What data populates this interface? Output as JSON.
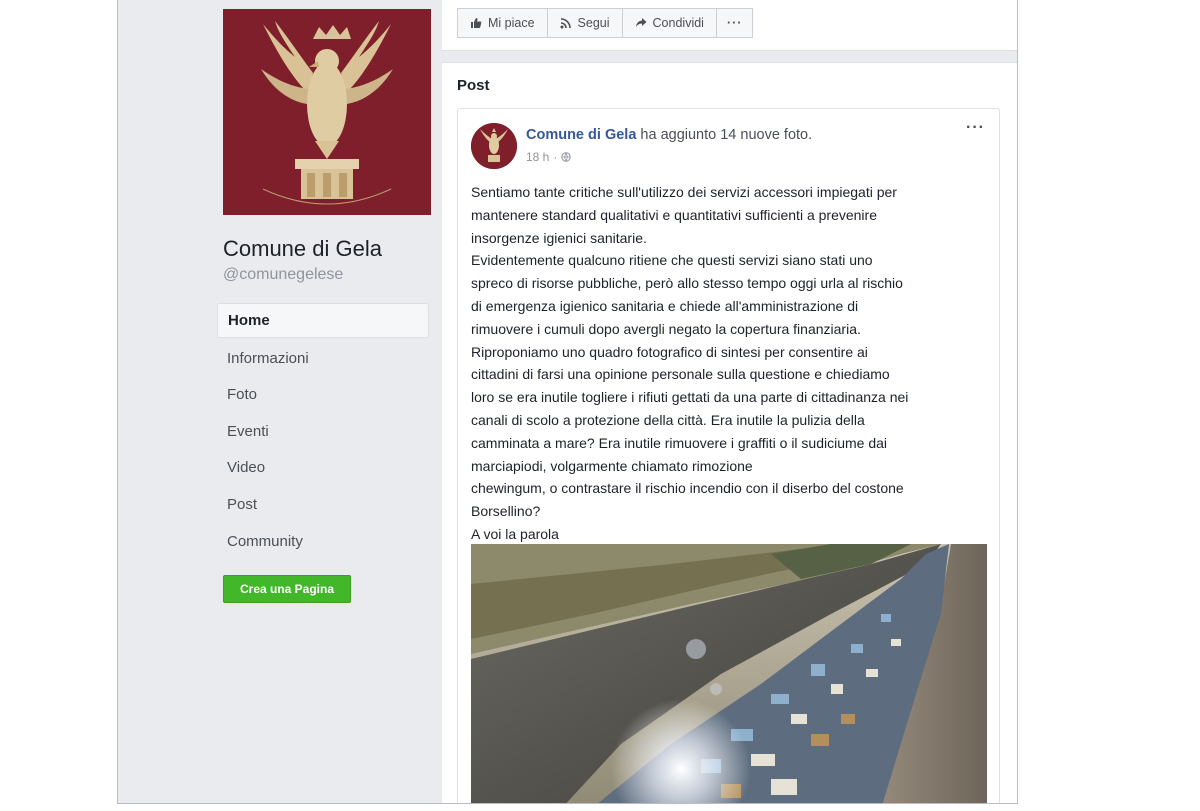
{
  "page": {
    "name": "Comune di Gela",
    "handle": "@comunegelese",
    "nav": [
      "Home",
      "Informazioni",
      "Foto",
      "Eventi",
      "Video",
      "Post",
      "Community"
    ],
    "active_nav": "Home",
    "create_page_label": "Crea una Pagina",
    "logo_inscription": "MVNICIPIO GELENSE"
  },
  "actions": {
    "like_label": "Mi piace",
    "follow_label": "Segui",
    "share_label": "Condividi",
    "more_label": "···"
  },
  "posts_section": {
    "title": "Post"
  },
  "post": {
    "author": "Comune di Gela",
    "action_text": "ha aggiunto 14 nuove foto.",
    "time": "18 h",
    "menu_label": "···",
    "lines": [
      "Sentiamo tante critiche sull'utilizzo dei servizi accessori impiegati per",
      "mantenere standard qualitativi e quantitativi sufficienti a prevenire",
      "insorgenze igienici sanitarie.",
      "Evidentemente qualcuno ritiene che questi servizi siano stati uno",
      "spreco di risorse pubbliche, però allo stesso tempo oggi urla al rischio",
      "di emergenza igienico sanitaria e chiede all'amministrazione di",
      "rimuovere i cumuli dopo avergli negato la copertura finanziaria.",
      "Riproponiamo uno quadro fotografico di sintesi per consentire ai",
      "cittadini di farsi una opinione personale sulla questione e chiediamo",
      "loro se era inutile togliere i rifiuti gettati da una parte di cittadinanza nei",
      "canali di scolo a protezione della città. Era inutile la pulizia della",
      "camminata a mare? Era inutile rimuovere i graffiti o il sudiciume dai",
      "marciapiodi, volgarmente chiamato rimozione",
      "chewingum, o contrastare il rischio incendio con il diserbo del costone",
      "Borsellino?",
      "A voi la parola"
    ]
  },
  "colors": {
    "brand_maroon": "#7e1f2b",
    "link_blue": "#365899",
    "create_green": "#42b72a",
    "background": "#e9ebee"
  },
  "icons": {
    "like": "thumbs-up-icon",
    "follow": "rss-icon",
    "share": "share-arrow-icon",
    "globe": "globe-icon"
  }
}
